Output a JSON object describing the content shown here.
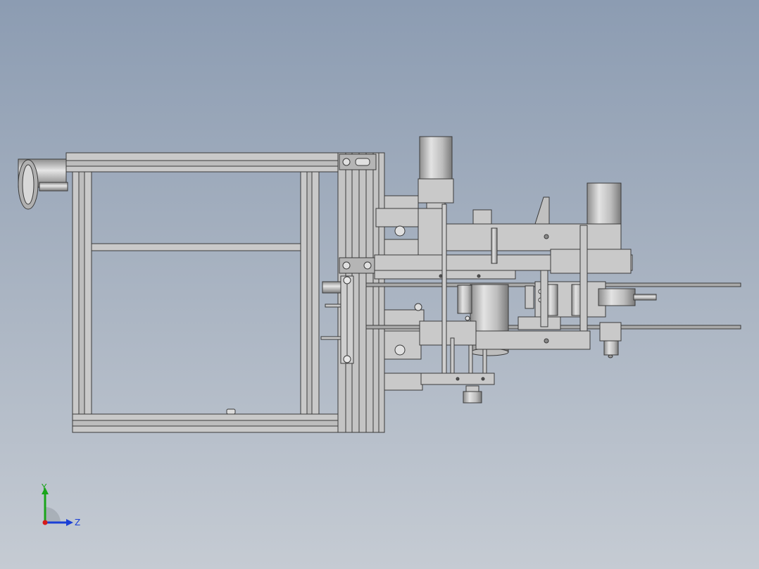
{
  "viewport": {
    "background_top": "#8c9cb2",
    "background_bottom": "#c5cbd3",
    "model_fill": "#c9c9c9",
    "model_edge": "#3a3a3a"
  },
  "triad": {
    "y_label": "Y",
    "z_label": "Z",
    "y_color": "#1aa51a",
    "z_color": "#1a3fd6",
    "x_color": "#d61a1a"
  }
}
